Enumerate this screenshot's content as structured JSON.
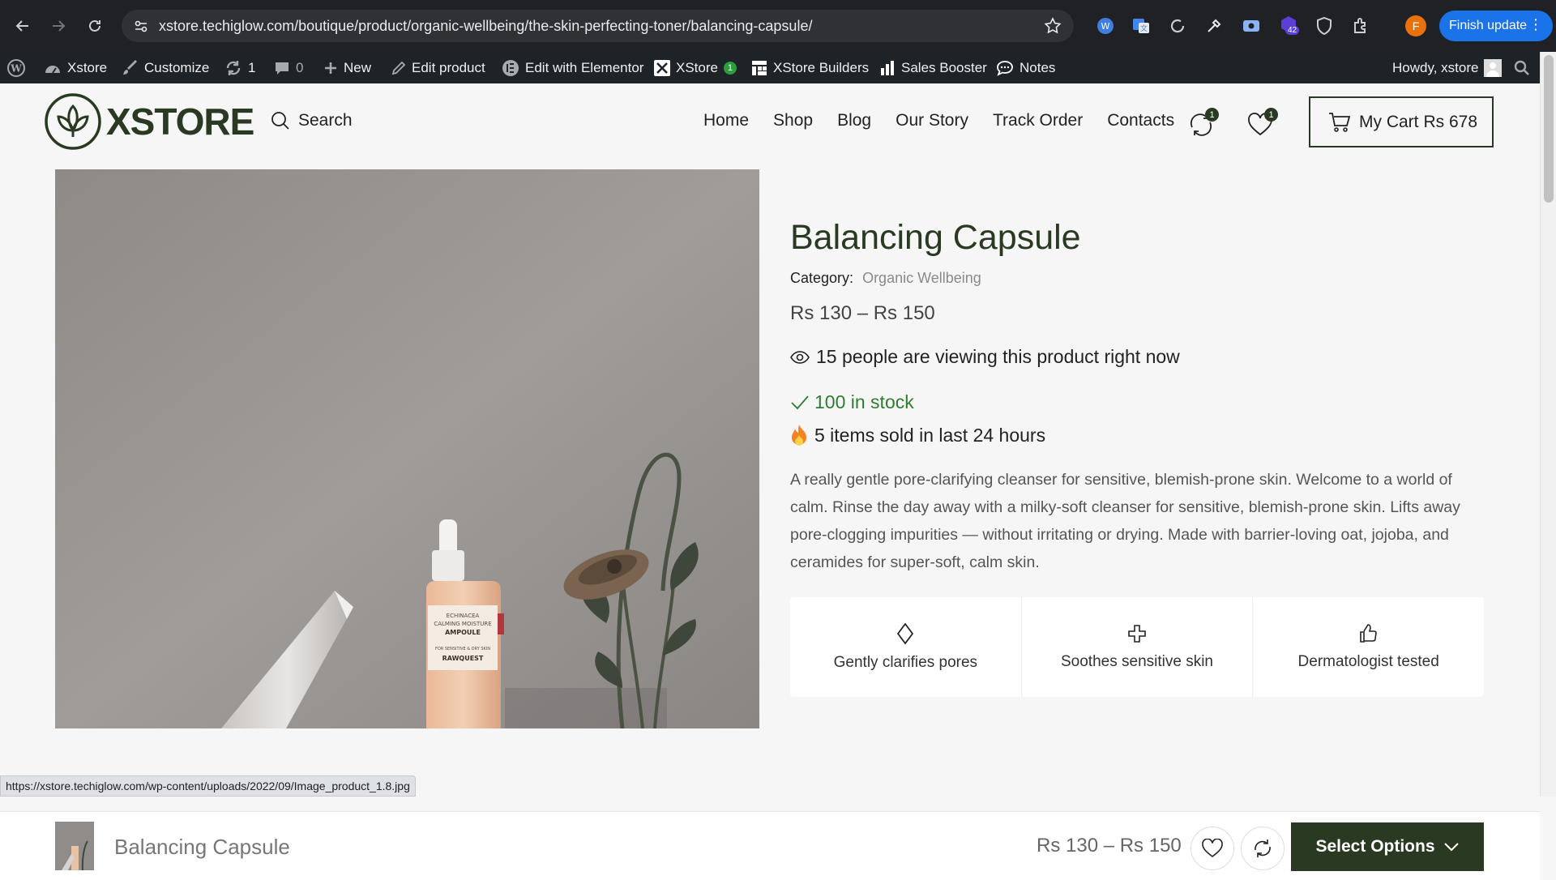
{
  "browser": {
    "url": "xstore.techiglow.com/boutique/product/organic-wellbeing/the-skin-perfecting-toner/balancing-capsule/",
    "profile_initial": "F",
    "ext_badge": "42",
    "finish_update": "Finish update"
  },
  "adminbar": {
    "site": "Xstore",
    "customize": "Customize",
    "updates_count": "1",
    "comments_count": "0",
    "new": "New",
    "edit_product": "Edit product",
    "edit_elementor": "Edit with Elementor",
    "xstore": "XStore",
    "xstore_badge": "1",
    "builders": "XStore Builders",
    "sales_booster": "Sales Booster",
    "notes": "Notes",
    "howdy": "Howdy, xstore"
  },
  "header": {
    "logo": "XSTORE",
    "search": "Search",
    "menu": [
      "Home",
      "Shop",
      "Blog",
      "Our Story",
      "Track Order",
      "Contacts"
    ],
    "compare_count": "1",
    "wishlist_count": "1",
    "cart_label": "My Cart",
    "cart_total": "Rs 678"
  },
  "product": {
    "title": "Balancing Capsule",
    "category_label": "Category:",
    "category": "Organic Wellbeing",
    "price": "Rs 130 – Rs 150",
    "viewing": "15 people are viewing this product right now",
    "stock": "100 in stock",
    "sold": "5 items sold in last 24 hours",
    "description": "A really gentle pore-clarifying cleanser for sensitive, blemish-prone skin. Welcome to a world of calm. Rinse the day away with a milky-soft cleanser for sensitive, blemish-prone skin. Lifts away pore-clogging impurities — without irritating or drying. Made with barrier-loving oat, jojoba, and ceramides for super-soft, calm skin.",
    "features": [
      {
        "icon": "diamond-icon",
        "label": "Gently clarifies pores"
      },
      {
        "icon": "plus-icon",
        "label": "Soothes sensitive skin"
      },
      {
        "icon": "thumbs-up-icon",
        "label": "Dermatologist tested"
      }
    ],
    "bottle_text": [
      "ECHINACEA",
      "CALMING MOISTURE",
      "AMPOULE",
      "FOR SENSITIVE & DRY SKIN",
      "RAWQUEST"
    ]
  },
  "sticky": {
    "name": "Balancing Capsule",
    "price": "Rs 130 – Rs 150",
    "select": "Select Options"
  },
  "status_url": "https://xstore.techiglow.com/wp-content/uploads/2022/09/Image_product_1.8.jpg"
}
